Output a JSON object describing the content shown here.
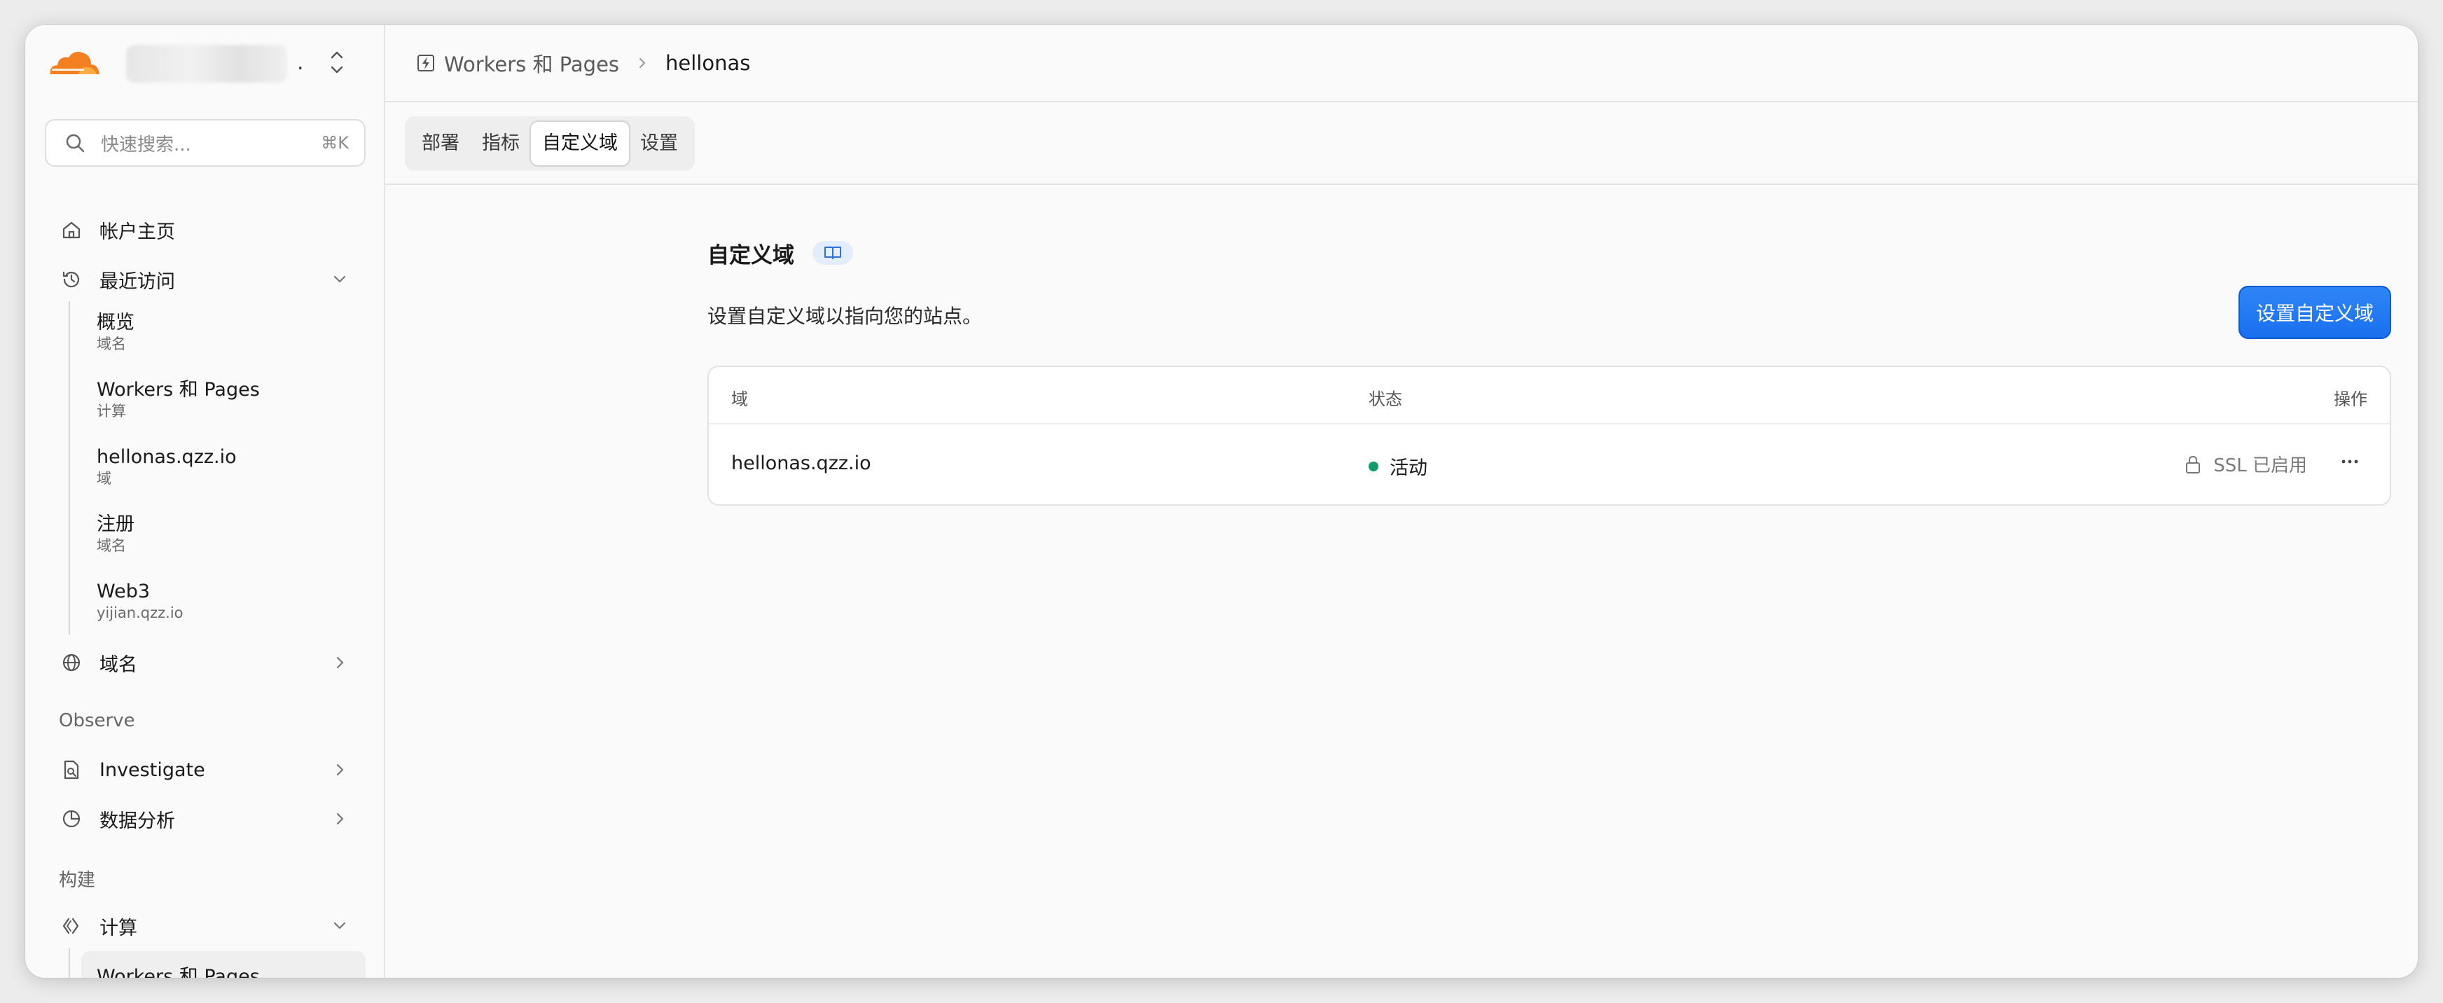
{
  "colors": {
    "accent": "#1a6fee",
    "cloudflare_orange": "#f38020",
    "status_active": "#0f9d6b"
  },
  "sidebar": {
    "search": {
      "placeholder": "快速搜索...",
      "shortcut": "⌘K"
    },
    "account_home": "帐户主页",
    "recent": {
      "label": "最近访问",
      "items": [
        {
          "title": "概览",
          "subtitle": "域名"
        },
        {
          "title": "Workers 和 Pages",
          "subtitle": "计算"
        },
        {
          "title": "hellonas.qzz.io",
          "subtitle": "域"
        },
        {
          "title": "注册",
          "subtitle": "域名"
        },
        {
          "title": "Web3",
          "subtitle": "yijian.qzz.io"
        }
      ]
    },
    "domains": "域名",
    "observe_label": "Observe",
    "investigate": "Investigate",
    "analytics": "数据分析",
    "build_label": "构建",
    "compute": "计算",
    "compute_active_item": "Workers 和 Pages"
  },
  "breadcrumb": {
    "parent": "Workers 和 Pages",
    "current": "hellonas"
  },
  "tabs": [
    {
      "label": "部署",
      "active": false
    },
    {
      "label": "指标",
      "active": false
    },
    {
      "label": "自定义域",
      "active": true
    },
    {
      "label": "设置",
      "active": false
    }
  ],
  "page": {
    "title": "自定义域",
    "description": "设置自定义域以指向您的站点。",
    "primary_button": "设置自定义域"
  },
  "table": {
    "columns": [
      "域",
      "状态",
      "操作"
    ],
    "rows": [
      {
        "domain": "hellonas.qzz.io",
        "status": "活动",
        "ssl": "SSL 已启用"
      }
    ]
  }
}
